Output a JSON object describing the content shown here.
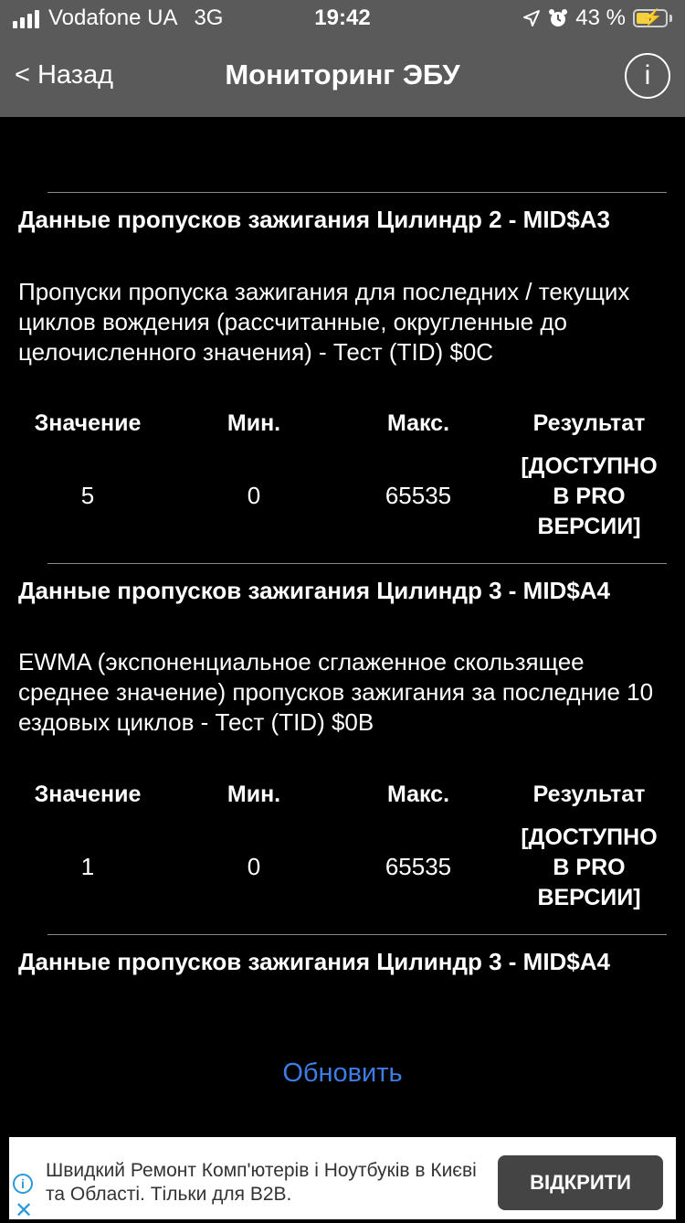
{
  "status_bar": {
    "carrier": "Vodafone UA",
    "network": "3G",
    "time": "19:42",
    "battery": "43 %",
    "icons": [
      "signal-icon",
      "location-arrow-icon",
      "alarm-icon",
      "battery-charging-icon"
    ]
  },
  "nav": {
    "back_label": "< Назад",
    "title": "Мониторинг ЭБУ",
    "info_glyph": "i"
  },
  "columns": {
    "value": "Значение",
    "min": "Мин.",
    "max": "Макс.",
    "result": "Результат"
  },
  "entries": [
    {
      "title": "Данные пропусков зажигания Цилиндр 2 - MID$A3",
      "description": "Пропуски пропуска зажигания для последних / текущих циклов вождения (рассчитанные, округленные до целочисленного значения) - Тест (TID) $0C",
      "value": "5",
      "min": "0",
      "max": "65535",
      "result": "[ДОСТУПНО В PRO ВЕРСИИ]"
    },
    {
      "title": "Данные пропусков зажигания Цилиндр 3 - MID$A4",
      "description": "EWMA (экспоненциальное сглаженное скользящее среднее значение) пропусков зажигания за последние 10 ездовых циклов - Тест (TID) $0B",
      "value": "1",
      "min": "0",
      "max": "65535",
      "result": "[ДОСТУПНО В PRO ВЕРСИИ]"
    },
    {
      "title": "Данные пропусков зажигания Цилиндр 3 - MID$A4"
    }
  ],
  "refresh_label": "Обновить",
  "ad": {
    "text": "Швидкий Ремонт Комп'ютерів і Ноутбуків в Києві та Області. Тільки для B2B.",
    "button_label": "ВІДКРИТИ",
    "info_glyph": "i",
    "close_glyph": "✕"
  },
  "colors": {
    "background": "#000000",
    "nav_bar": "#5a5a5a",
    "link": "#3d7ee6",
    "ad_button": "#444444"
  }
}
